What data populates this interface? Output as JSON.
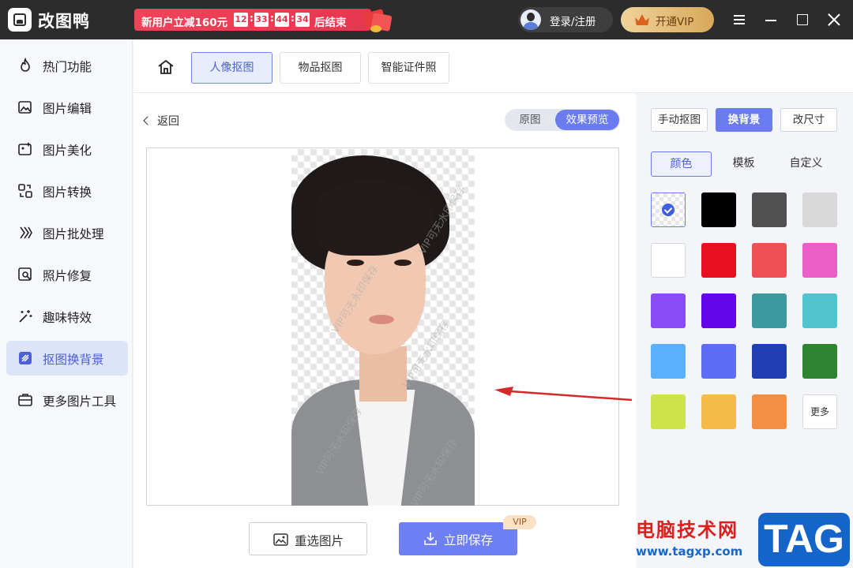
{
  "app": {
    "name": "改图鸭"
  },
  "promo": {
    "text": "新用户立减160元",
    "hh": "12",
    "mm": "33",
    "ss": "44",
    "ms": "34",
    "suffix": "后结束"
  },
  "header": {
    "login_label": "登录/注册",
    "vip_label": "开通VIP"
  },
  "sidebar": {
    "items": [
      {
        "label": "热门功能",
        "icon": "flame-icon"
      },
      {
        "label": "图片编辑",
        "icon": "image-edit-icon"
      },
      {
        "label": "图片美化",
        "icon": "image-beauty-icon"
      },
      {
        "label": "图片转换",
        "icon": "convert-icon"
      },
      {
        "label": "图片批处理",
        "icon": "batch-icon"
      },
      {
        "label": "照片修复",
        "icon": "photo-repair-icon"
      },
      {
        "label": "趣味特效",
        "icon": "magic-wand-icon"
      },
      {
        "label": "抠图换背景",
        "icon": "cutout-icon",
        "active": true
      },
      {
        "label": "更多图片工具",
        "icon": "toolbox-icon"
      }
    ]
  },
  "tabs": [
    {
      "label": "人像抠图",
      "active": true
    },
    {
      "label": "物品抠图"
    },
    {
      "label": "智能证件照"
    }
  ],
  "main": {
    "back_label": "返回",
    "view_toggle": {
      "original": "原图",
      "preview": "效果预览",
      "selected": "preview"
    },
    "watermark_text": "VIP可无水印保存",
    "reselect_label": "重选图片",
    "save_label": "立即保存",
    "save_badge": "VIP"
  },
  "right_panel": {
    "mode_buttons": [
      {
        "label": "手动抠图"
      },
      {
        "label": "换背景",
        "active": true
      },
      {
        "label": "改尺寸"
      }
    ],
    "bg_tabs": [
      {
        "label": "颜色",
        "active": true
      },
      {
        "label": "模板"
      },
      {
        "label": "自定义"
      }
    ],
    "colors": [
      "transparent",
      "#000000",
      "#505050",
      "#d9d9d9",
      "#ffffff",
      "#e8101e",
      "#ef5055",
      "#ec5ec8",
      "#8a4cf7",
      "#6505ea",
      "#3e9a9f",
      "#50c4cf",
      "#5ab0fa",
      "#5f6cf5",
      "#1f3fb3",
      "#2e8430",
      "#cde44b",
      "#f5bb48",
      "#f38f43"
    ],
    "selected_color": "transparent",
    "more_label": "更多"
  },
  "site_watermark": {
    "name": "电脑技术网",
    "url": "www.tagxp.com",
    "tag": "TAG"
  },
  "colors": {
    "accent": "#6a7cf0",
    "titlebar": "#2c2c2c",
    "promo": "#e8364f"
  }
}
